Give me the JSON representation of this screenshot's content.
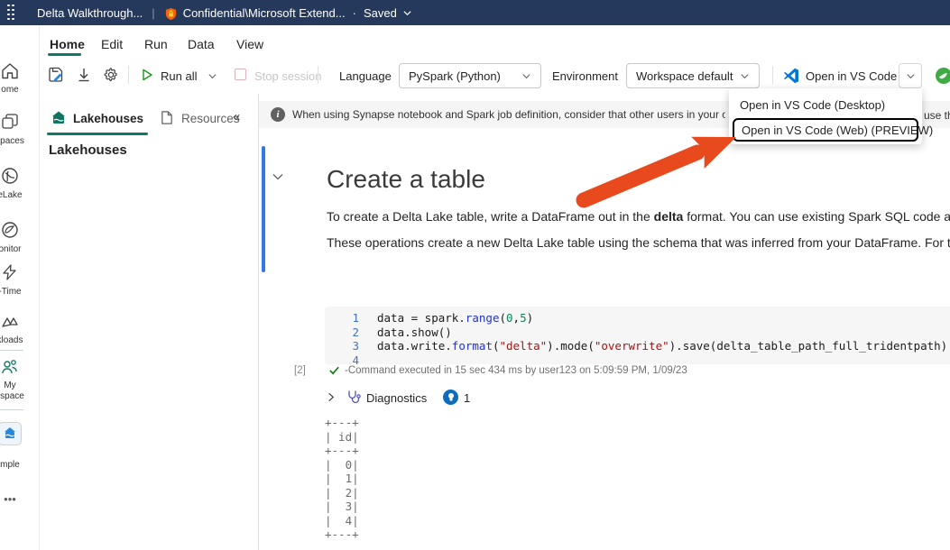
{
  "colors": {
    "topbar_bg": "#24395b",
    "accent_teal": "#117865",
    "cell_indicator_blue": "#3078e4",
    "arrow_orange": "#e8491d",
    "vscode_blue": "#0078d4",
    "diagnostics_badge_blue": "#0f6cbd",
    "string_red": "#a31515",
    "builtin_blue": "#2233cc",
    "number_green": "#098658"
  },
  "topbar": {
    "title": "Delta Walkthrough...",
    "sensitivity_label": "Confidential\\Microsoft Extend...",
    "separator_dot": "·",
    "saved_status": "Saved"
  },
  "menus": [
    "Home",
    "Edit",
    "Run",
    "Data",
    "View"
  ],
  "toolbar": {
    "run_all_label": "Run all",
    "stop_session_label": "Stop session",
    "language_label": "Language",
    "language_value": "PySpark (Python)",
    "environment_label": "Environment",
    "environment_value": "Workspace default",
    "vscode_button_label": "Open in VS Code"
  },
  "vscode_menu": {
    "items": [
      "Open in VS Code (Desktop)",
      "Open in VS Code (Web) (PREVIEW)"
    ],
    "highlighted_index": 1
  },
  "rail": {
    "items": [
      {
        "label": "ome"
      },
      {
        "label": "spaces"
      },
      {
        "label": "eLake"
      },
      {
        "label": "onitor"
      },
      {
        "label": "-Time"
      },
      {
        "label": "kloads"
      },
      {
        "label_line1": "My",
        "label_line2": "kspace"
      },
      {
        "label": "mple"
      },
      {
        "label": "•••"
      }
    ]
  },
  "panel": {
    "tabs": [
      {
        "label": "Lakehouses"
      },
      {
        "label": "Resources"
      }
    ],
    "collapse_glyph": "«",
    "heading": "Lakehouses"
  },
  "banner": {
    "text": "When using Synapse notebook and Spark job definition, consider that other users in your organization",
    "text_right_fragment": "use the"
  },
  "markdown_cell": {
    "heading": "Create a table",
    "p1_before": "To create a Delta Lake table, write a DataFrame out in the ",
    "p1_bold": "delta",
    "p1_after": " format. You can use existing Spark SQL code and change",
    "p2": "These operations create a new Delta Lake table using the schema that was inferred from your DataFrame. For the full set"
  },
  "code": {
    "lines": [
      {
        "n": "1",
        "tokens": [
          {
            "t": "data = spark.",
            "c": "d"
          },
          {
            "t": "range",
            "c": "fn"
          },
          {
            "t": "(",
            "c": "d"
          },
          {
            "t": "0",
            "c": "num"
          },
          {
            "t": ",",
            "c": "d"
          },
          {
            "t": "5",
            "c": "num"
          },
          {
            "t": ")",
            "c": "d"
          }
        ]
      },
      {
        "n": "2",
        "tokens": [
          {
            "t": "data.show()",
            "c": "d"
          }
        ]
      },
      {
        "n": "3",
        "tokens": [
          {
            "t": "data.write.",
            "c": "d"
          },
          {
            "t": "format",
            "c": "fn"
          },
          {
            "t": "(",
            "c": "d"
          },
          {
            "t": "\"delta\"",
            "c": "str"
          },
          {
            "t": ").mode(",
            "c": "d"
          },
          {
            "t": "\"overwrite\"",
            "c": "str"
          },
          {
            "t": ").save(delta_table_path_full_tridentpath)",
            "c": "d"
          }
        ]
      },
      {
        "n": "4",
        "tokens": []
      }
    ]
  },
  "execution": {
    "count": "[2]",
    "status": "-Command executed in 15 sec 434 ms by user123 on 5:09:59 PM, 1/09/23"
  },
  "diagnostics": {
    "label": "Diagnostics",
    "badge_count": "1"
  },
  "output": {
    "lines": [
      "+---+",
      "| id|",
      "+---+",
      "|  0|",
      "|  1|",
      "|  2|",
      "|  3|",
      "|  4|",
      "+---+"
    ]
  }
}
